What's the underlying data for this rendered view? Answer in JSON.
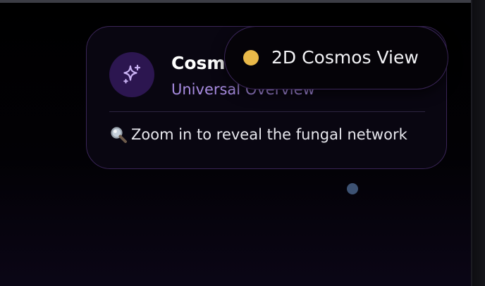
{
  "card": {
    "title": "Cosmos",
    "subtitle": "Universal Overview",
    "hint": "Zoom in to reveal the fungal network",
    "icon": "sparkle-icon",
    "hint_icon": "magnifier-icon"
  },
  "view_toggle": {
    "label": "2D Cosmos View",
    "indicator_color": "#e9b949"
  },
  "node": {
    "color": "#3d5273"
  },
  "colors": {
    "accent_purple": "#a78be0",
    "icon_background": "#2c1650",
    "border": "#3a2558"
  }
}
